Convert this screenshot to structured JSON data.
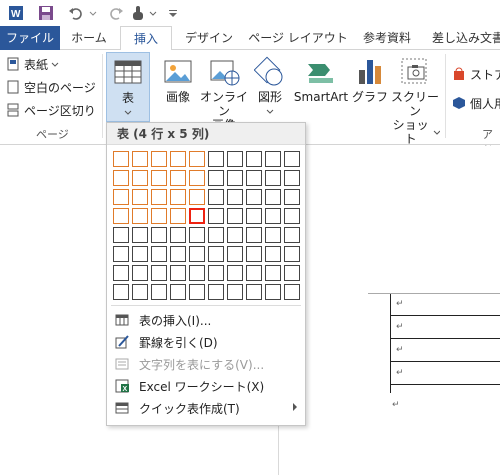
{
  "qat": {
    "icons": [
      "word-icon",
      "save-icon",
      "undo-icon",
      "redo-icon",
      "touch-mode-icon",
      "customize-icon"
    ]
  },
  "tabs": [
    {
      "label": "ファイル"
    },
    {
      "label": "ホーム"
    },
    {
      "label": "挿入"
    },
    {
      "label": "デザイン"
    },
    {
      "label": "ページ レイアウト"
    },
    {
      "label": "参考資料"
    },
    {
      "label": "差し込み文書"
    }
  ],
  "ribbon": {
    "pages_group": {
      "cover": "表紙",
      "blank": "空白のページ",
      "break": "ページ区切り",
      "label": "ページ"
    },
    "table_button": "表",
    "picture": "画像",
    "online_picture_1": "オンライン",
    "online_picture_2": "画像",
    "shapes": "図形",
    "smartart": "SmartArt",
    "chart": "グラフ",
    "screenshot_1": "スクリーン",
    "screenshot_2": "ショット",
    "store": "ストア",
    "personal_apps": "個人用",
    "addins_label": "アド"
  },
  "dropdown": {
    "title": "表 (4 行 x 5 列)",
    "grid_cols": 10,
    "grid_rows": 8,
    "selected_rows": 4,
    "selected_cols": 5,
    "menu": [
      {
        "label": "表の挿入(I)...",
        "icon": "insert-table-icon",
        "disabled": false
      },
      {
        "label": "罫線を引く(D)",
        "icon": "draw-table-icon",
        "disabled": false
      },
      {
        "label": "文字列を表にする(V)...",
        "icon": "text-to-table-icon",
        "disabled": true
      },
      {
        "label": "Excel ワークシート(X)",
        "icon": "excel-icon",
        "disabled": false
      },
      {
        "label": "クイック表作成(T)",
        "icon": "quick-table-icon",
        "disabled": false
      }
    ]
  },
  "document": {
    "paragraph_mark": "↵",
    "table_rows": 4
  },
  "colors": {
    "file_tab": "#2b579a",
    "highlight": "#e07b2a",
    "current_cell": "#ee2211"
  }
}
